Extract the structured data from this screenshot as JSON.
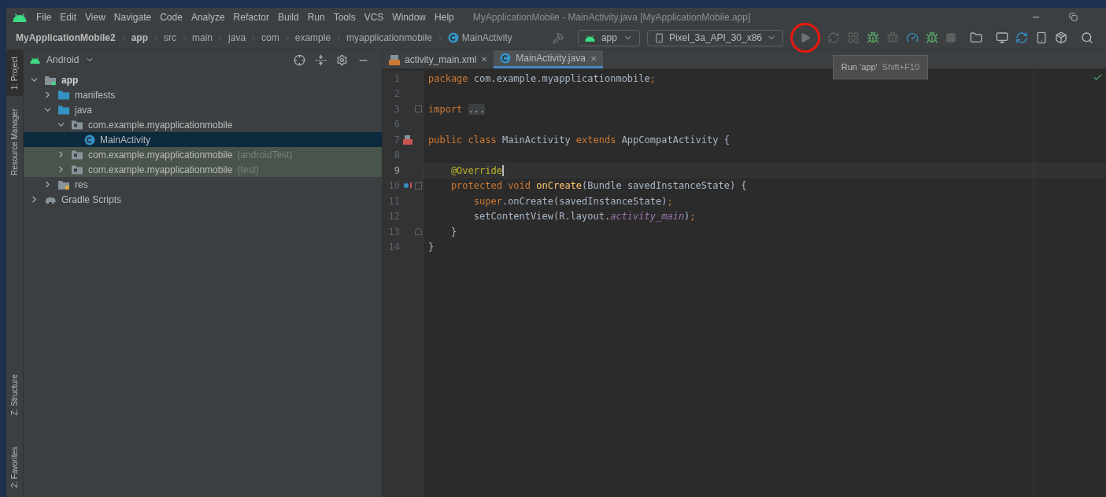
{
  "window": {
    "title": "MyApplicationMobile - MainActivity.java [MyApplicationMobile.app]"
  },
  "menu": [
    "File",
    "Edit",
    "View",
    "Navigate",
    "Code",
    "Analyze",
    "Refactor",
    "Build",
    "Run",
    "Tools",
    "VCS",
    "Window",
    "Help"
  ],
  "breadcrumbs": [
    {
      "label": "MyApplicationMobile2",
      "bold": true
    },
    {
      "label": "app",
      "bold": true
    },
    {
      "label": "src",
      "bold": false
    },
    {
      "label": "main",
      "bold": false
    },
    {
      "label": "java",
      "bold": false
    },
    {
      "label": "com",
      "bold": false
    },
    {
      "label": "example",
      "bold": false
    },
    {
      "label": "myapplicationmobile",
      "bold": false
    },
    {
      "label": "MainActivity",
      "bold": false,
      "kind": "class"
    }
  ],
  "toolbar": {
    "config": "app",
    "device": "Pixel_3a_API_30_x86",
    "tooltip": {
      "label": "Run 'app'",
      "shortcut": "Shift+F10"
    }
  },
  "side_tabs_top": [
    {
      "label": "1: Project",
      "selected": true
    },
    {
      "label": "Resource Manager",
      "selected": false
    }
  ],
  "side_tabs_bottom": [
    {
      "label": "Z: Structure",
      "selected": false
    },
    {
      "label": "2: Favorites",
      "selected": false
    }
  ],
  "project": {
    "view": "Android",
    "tree": [
      {
        "label": "app",
        "kind": "module",
        "expanded": true,
        "selected": false,
        "test_root": false,
        "children": [
          {
            "label": "manifests",
            "kind": "folder",
            "expanded": false,
            "selected": false,
            "test_root": false
          },
          {
            "label": "java",
            "kind": "folder",
            "expanded": true,
            "selected": false,
            "test_root": false,
            "children": [
              {
                "label": "com.example.myapplicationmobile",
                "kind": "package",
                "expanded": true,
                "selected": false,
                "test_root": false,
                "children": [
                  {
                    "label": "MainActivity",
                    "kind": "class",
                    "selected": true,
                    "test_root": false
                  }
                ]
              },
              {
                "label": "com.example.myapplicationmobile",
                "suffix": "(androidTest)",
                "kind": "package",
                "expanded": false,
                "selected": false,
                "test_root": true
              },
              {
                "label": "com.example.myapplicationmobile",
                "suffix": "(test)",
                "kind": "package",
                "expanded": false,
                "selected": false,
                "test_root": true
              }
            ]
          },
          {
            "label": "res",
            "kind": "res",
            "expanded": false,
            "selected": false,
            "test_root": false
          }
        ]
      },
      {
        "label": "Gradle Scripts",
        "kind": "gradle",
        "expanded": false,
        "selected": false,
        "test_root": false
      }
    ]
  },
  "tabs": [
    {
      "label": "activity_main.xml",
      "kind": "xml",
      "selected": false,
      "close": "✕"
    },
    {
      "label": "MainActivity.java",
      "kind": "class",
      "selected": true,
      "close": "✕"
    }
  ],
  "editor": {
    "lines": [
      {
        "number": "1",
        "current": false,
        "tokens": [
          {
            "kind": "kw",
            "text": "package "
          },
          {
            "kind": "plain",
            "text": "com.example.myapplicationmobile"
          },
          {
            "kind": "kw",
            "text": ";"
          }
        ]
      },
      {
        "number": "2",
        "current": false
      },
      {
        "number": "3",
        "current": false,
        "fold_start": true,
        "tokens": [
          {
            "kind": "kw",
            "text": "import "
          },
          {
            "kind": "folded",
            "text": "..."
          }
        ]
      },
      {
        "number": "6",
        "current": false
      },
      {
        "number": "7",
        "current": false,
        "activity_icon": true,
        "tokens": [
          {
            "kind": "kw",
            "text": "public class "
          },
          {
            "kind": "plain",
            "text": "MainActivity "
          },
          {
            "kind": "kw",
            "text": "extends "
          },
          {
            "kind": "plain",
            "text": "AppCompatActivity {"
          }
        ]
      },
      {
        "number": "8",
        "current": false
      },
      {
        "number": "9",
        "current": true,
        "tokens": [
          {
            "kind": "annot",
            "text": "    @Override"
          }
        ]
      },
      {
        "number": "10",
        "current": false,
        "override_icon": true,
        "fold_start": true,
        "tokens": [
          {
            "kind": "kw",
            "text": "    protected void "
          },
          {
            "kind": "method",
            "text": "onCreate"
          },
          {
            "kind": "plain",
            "text": "(Bundle savedInstanceState) {"
          }
        ]
      },
      {
        "number": "11",
        "current": false,
        "tokens": [
          {
            "kind": "kw",
            "text": "        super"
          },
          {
            "kind": "plain",
            "text": ".onCreate(savedInstanceState)"
          },
          {
            "kind": "kw",
            "text": ";"
          }
        ]
      },
      {
        "number": "12",
        "current": false,
        "tokens": [
          {
            "kind": "plain",
            "text": "        setContentView(R.layout."
          },
          {
            "kind": "field",
            "text": "activity_main"
          },
          {
            "kind": "plain",
            "text": ")"
          },
          {
            "kind": "kw",
            "text": ";"
          }
        ]
      },
      {
        "number": "13",
        "current": false,
        "fold_end": true,
        "tokens": [
          {
            "kind": "plain",
            "text": "    }"
          }
        ]
      },
      {
        "number": "14",
        "current": false,
        "tokens": [
          {
            "kind": "plain",
            "text": "}"
          }
        ]
      }
    ]
  }
}
